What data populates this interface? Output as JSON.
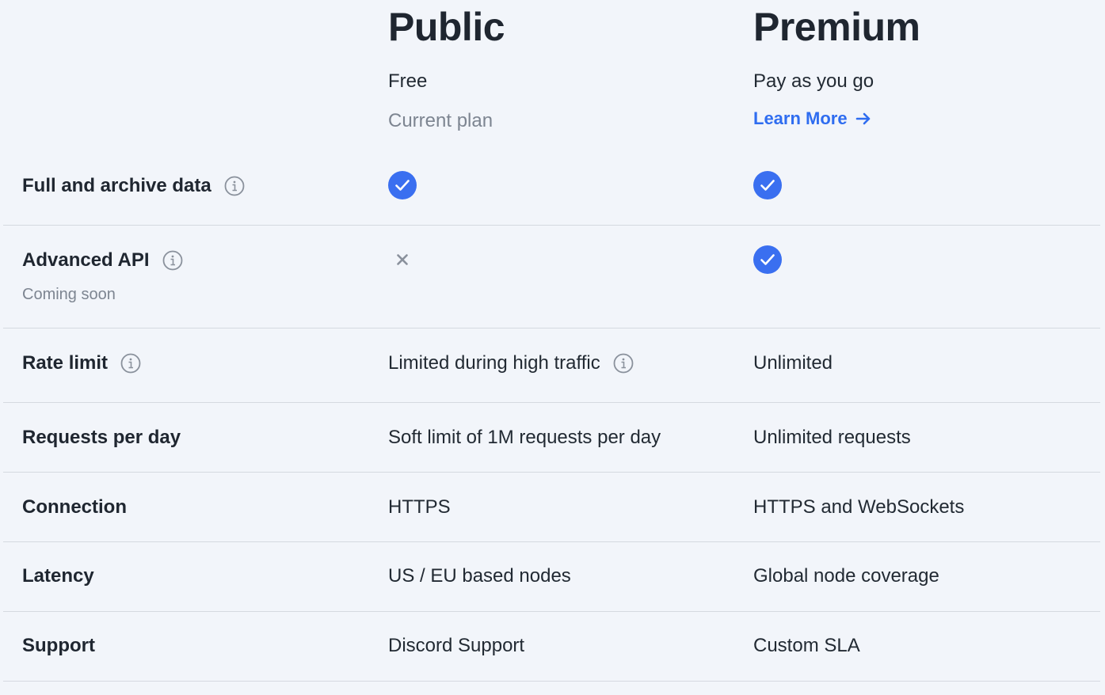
{
  "plans": {
    "public": {
      "title": "Public",
      "price": "Free",
      "status": "Current plan"
    },
    "premium": {
      "title": "Premium",
      "price": "Pay as you go",
      "link_label": "Learn More"
    }
  },
  "rows": [
    {
      "label": "Full and archive data",
      "has_info": true,
      "public": "check",
      "premium": "check"
    },
    {
      "label": "Advanced API",
      "sublabel": "Coming soon",
      "has_info": true,
      "public": "cross",
      "premium": "check"
    },
    {
      "label": "Rate limit",
      "has_info": true,
      "public_text": "Limited during high traffic",
      "public_info": true,
      "premium_text": "Unlimited"
    },
    {
      "label": "Requests per day",
      "public_text": "Soft limit of 1M requests per day",
      "premium_text": "Unlimited requests"
    },
    {
      "label": "Connection",
      "public_text": "HTTPS",
      "premium_text": "HTTPS and WebSockets"
    },
    {
      "label": "Latency",
      "public_text": "US / EU based nodes",
      "premium_text": "Global node coverage"
    },
    {
      "label": "Support",
      "public_text": "Discord Support",
      "premium_text": "Custom SLA"
    }
  ],
  "icons": {
    "check": "check-circle-icon",
    "cross": "x-icon",
    "info": "info-icon",
    "arrow": "arrow-right-icon"
  },
  "colors": {
    "background": "#f2f5fa",
    "accent": "#2f6df0",
    "check_fill": "#3a6ff0",
    "muted_text": "#7d8591",
    "divider": "#d5d9e0",
    "icon_gray": "#8a919c"
  }
}
